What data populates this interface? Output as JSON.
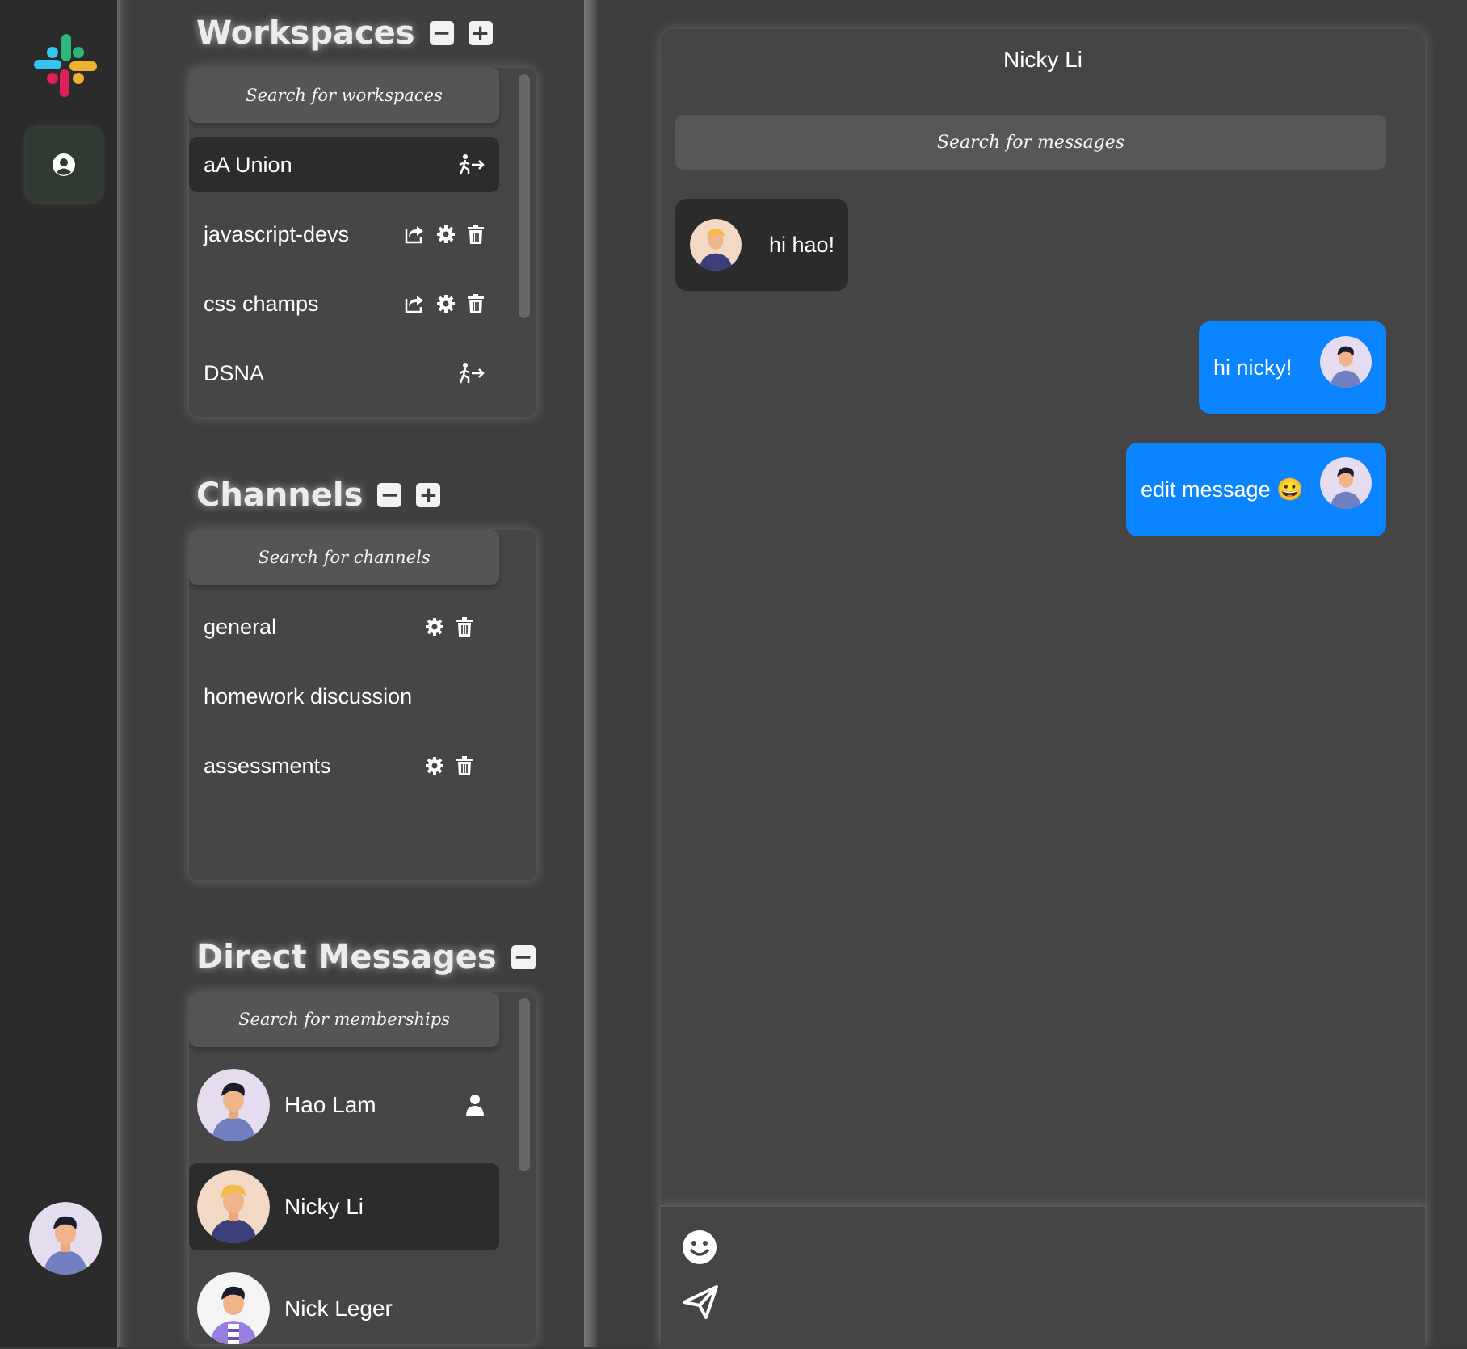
{
  "workspaces": {
    "title": "Workspaces",
    "collapse_label": "−",
    "add_label": "+",
    "search_placeholder": "Search for workspaces",
    "items": [
      {
        "label": "aA Union",
        "active": true,
        "actions": [
          "leave-icon"
        ]
      },
      {
        "label": "javascript-devs",
        "active": false,
        "actions": [
          "share-icon",
          "gear-icon",
          "trash-icon"
        ]
      },
      {
        "label": "css champs",
        "active": false,
        "actions": [
          "share-icon",
          "gear-icon",
          "trash-icon"
        ]
      },
      {
        "label": "DSNA",
        "active": false,
        "actions": [
          "leave-icon"
        ]
      }
    ]
  },
  "channels": {
    "title": "Channels",
    "collapse_label": "−",
    "add_label": "+",
    "search_placeholder": "Search for channels",
    "items": [
      {
        "label": "general",
        "actions": [
          "gear-icon",
          "trash-icon"
        ]
      },
      {
        "label": "homework discussion",
        "actions": []
      },
      {
        "label": "assessments",
        "actions": [
          "gear-icon",
          "trash-icon"
        ]
      }
    ]
  },
  "direct_messages": {
    "title": "Direct Messages",
    "collapse_label": "−",
    "search_placeholder": "Search for memberships",
    "items": [
      {
        "label": "Hao Lam",
        "active": false,
        "badge": "person-icon"
      },
      {
        "label": "Nicky Li",
        "active": true
      },
      {
        "label": "Nick Leger",
        "active": false
      }
    ]
  },
  "chat": {
    "title": "Nicky Li",
    "search_placeholder": "Search for messages",
    "messages": [
      {
        "text": "hi hao!",
        "direction": "incoming"
      },
      {
        "text": "hi nicky!",
        "direction": "outgoing"
      },
      {
        "text": "edit message 😀",
        "direction": "outgoing"
      }
    ]
  },
  "colors": {
    "outgoing_bubble": "#0a84ff",
    "incoming_bubble": "#2b2b2b",
    "panel": "#464646"
  }
}
